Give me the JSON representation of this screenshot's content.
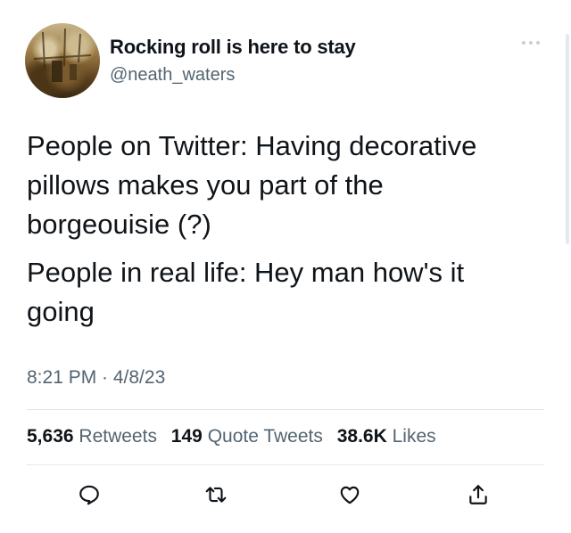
{
  "user": {
    "display_name": "Rocking roll is here to stay",
    "handle": "@neath_waters",
    "avatar_icon": "avatar-photo"
  },
  "tweet": {
    "paragraphs": [
      "People on Twitter: Having decorative pillows makes you part of the borgeouisie (?)",
      "People in real life: Hey man how's it going"
    ],
    "timestamp": "8:21 PM · 4/8/23"
  },
  "stats": [
    {
      "count": "5,636",
      "label": "Retweets"
    },
    {
      "count": "149",
      "label": "Quote Tweets"
    },
    {
      "count": "38.6K",
      "label": "Likes"
    }
  ],
  "actions": [
    {
      "icon": "reply-icon"
    },
    {
      "icon": "retweet-icon"
    },
    {
      "icon": "like-icon"
    },
    {
      "icon": "share-icon"
    }
  ],
  "colors": {
    "text_primary": "#0f1419",
    "text_secondary": "#536471",
    "divider": "#e4e8eb"
  }
}
